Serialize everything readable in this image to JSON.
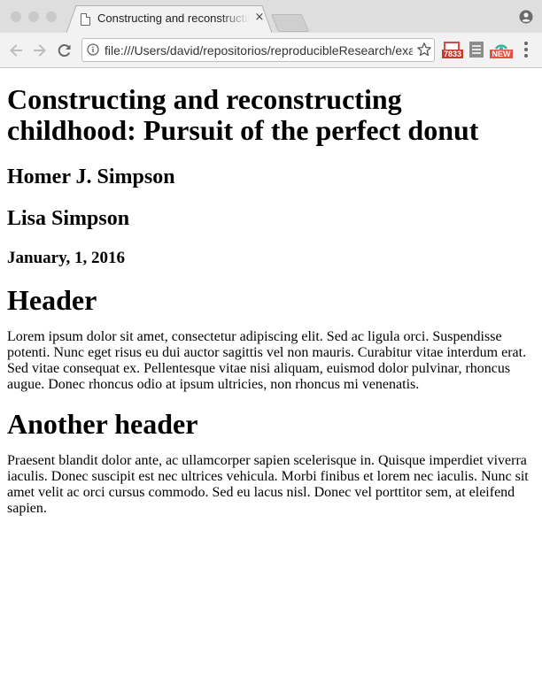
{
  "browser": {
    "tab_title": "Constructing and reconstructing childhood: Pursuit of the perfect donut",
    "tab_close": "×",
    "url": "file:///Users/david/repositorios/reproducibleResearch/example.html",
    "extensions": {
      "gmail_badge": "7833",
      "new_badge": "NEW"
    },
    "icons": {
      "back": "arrow-left",
      "forward": "arrow-right",
      "reload": "reload",
      "info": "info",
      "bookmark": "star",
      "menu": "vertical-dots",
      "profile": "person"
    }
  },
  "document": {
    "title": "Constructing and reconstructing childhood: Pursuit of the perfect donut",
    "authors": [
      "Homer J. Simpson",
      "Lisa Simpson"
    ],
    "date": "January, 1, 2016",
    "sections": [
      {
        "heading": "Header",
        "body": "Lorem ipsum dolor sit amet, consectetur adipiscing elit. Sed ac ligula orci. Suspendisse potenti. Nunc eget risus eu dui auctor sagittis vel non mauris. Curabitur vitae interdum erat. Sed vitae consequat ex. Pellentesque vitae nisi aliquam, euismod dolor pulvinar, rhoncus augue. Donec rhoncus odio at ipsum ultricies, non rhoncus mi venenatis."
      },
      {
        "heading": "Another header",
        "body": "Praesent blandit dolor ante, ac ullamcorper sapien scelerisque in. Quisque imperdiet viverra iaculis. Donec suscipit est nec ultrices vehicula. Morbi finibus et lorem nec iaculis. Nunc sit amet velit ac orci cursus commodo. Sed eu lacus nisl. Donec vel porttitor sem, at eleifend sapien."
      }
    ]
  }
}
